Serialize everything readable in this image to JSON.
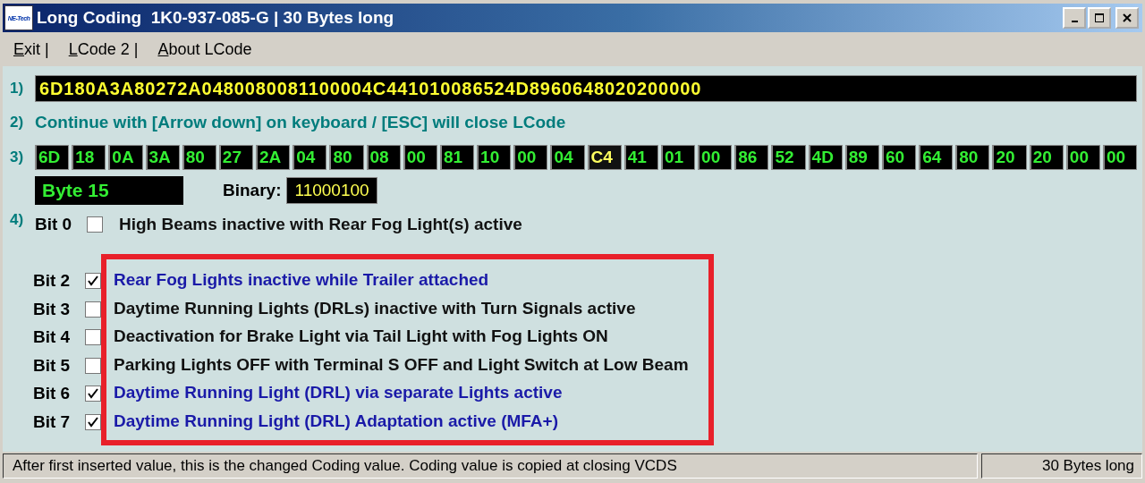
{
  "window": {
    "title": "Long Coding  1K0-937-085-G | 30 Bytes long",
    "logo": "NE-Tech"
  },
  "menu": [
    {
      "accel": "E",
      "rest": "xit |"
    },
    {
      "accel": "L",
      "rest": "Code 2 |"
    },
    {
      "accel": "A",
      "rest": "bout LCode"
    }
  ],
  "step1": {
    "number": "1)",
    "value": "6D180A3A80272A0480080081100004C441010086524D8960648020200000"
  },
  "step2": {
    "number": "2)",
    "text": "Continue with [Arrow down] on keyboard / [ESC] will close LCode"
  },
  "step3": {
    "number": "3)",
    "bytes": [
      {
        "value": "6D",
        "selected": false
      },
      {
        "value": "18",
        "selected": false
      },
      {
        "value": "0A",
        "selected": false
      },
      {
        "value": "3A",
        "selected": false
      },
      {
        "value": "80",
        "selected": false
      },
      {
        "value": "27",
        "selected": false
      },
      {
        "value": "2A",
        "selected": false
      },
      {
        "value": "04",
        "selected": false
      },
      {
        "value": "80",
        "selected": false
      },
      {
        "value": "08",
        "selected": false
      },
      {
        "value": "00",
        "selected": false
      },
      {
        "value": "81",
        "selected": false
      },
      {
        "value": "10",
        "selected": false
      },
      {
        "value": "00",
        "selected": false
      },
      {
        "value": "04",
        "selected": false
      },
      {
        "value": "C4",
        "selected": true
      },
      {
        "value": "41",
        "selected": false
      },
      {
        "value": "01",
        "selected": false
      },
      {
        "value": "00",
        "selected": false
      },
      {
        "value": "86",
        "selected": false
      },
      {
        "value": "52",
        "selected": false
      },
      {
        "value": "4D",
        "selected": false
      },
      {
        "value": "89",
        "selected": false
      },
      {
        "value": "60",
        "selected": false
      },
      {
        "value": "64",
        "selected": false
      },
      {
        "value": "80",
        "selected": false
      },
      {
        "value": "20",
        "selected": false
      },
      {
        "value": "20",
        "selected": false
      },
      {
        "value": "00",
        "selected": false
      },
      {
        "value": "00",
        "selected": false
      }
    ]
  },
  "byte_label": "Byte 15",
  "binary": {
    "label": "Binary:",
    "value": "11000100"
  },
  "step4": {
    "number": "4)",
    "bits": [
      {
        "label": "Bit 0",
        "checked": false,
        "text": "High Beams inactive with Rear Fog Light(s) active"
      }
    ],
    "highlighted_bits": [
      {
        "label": "Bit 2",
        "checked": true,
        "text": "Rear Fog Lights inactive while Trailer attached"
      },
      {
        "label": "Bit 3",
        "checked": false,
        "text": "Daytime Running Lights (DRLs) inactive with Turn Signals active"
      },
      {
        "label": "Bit 4",
        "checked": false,
        "text": "Deactivation for Brake Light via Tail Light with Fog Lights ON"
      },
      {
        "label": "Bit 5",
        "checked": false,
        "text": "Parking Lights OFF with Terminal S OFF and Light Switch at Low Beam"
      },
      {
        "label": "Bit 6",
        "checked": true,
        "text": "Daytime Running Light (DRL) via separate Lights active"
      },
      {
        "label": "Bit 7",
        "checked": true,
        "text": "Daytime Running Light (DRL) Adaptation active (MFA+)"
      }
    ]
  },
  "status_bar": [
    "After first inserted value, this is the changed Coding value.  Coding value is copied at closing VCDS",
    "30 Bytes long"
  ]
}
